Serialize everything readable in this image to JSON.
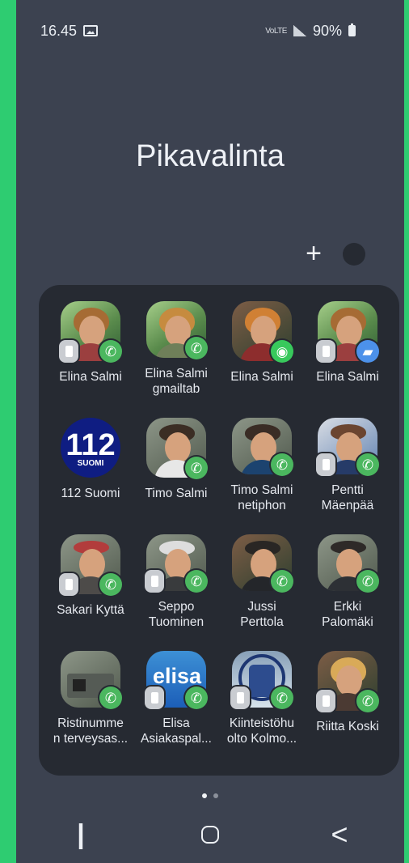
{
  "status_bar": {
    "time": "16.45",
    "network": "VoLTE",
    "battery": "90%"
  },
  "title": "Pikavalinta",
  "actions": {
    "add_label": "+"
  },
  "contacts": [
    {
      "label": "Elina Salmi"
    },
    {
      "label": "Elina Salmi\ngmailtab"
    },
    {
      "label": "Elina Salmi"
    },
    {
      "label": "Elina Salmi"
    },
    {
      "label": "112 Suomi",
      "logo_main": "112",
      "logo_sub": "SUOMI"
    },
    {
      "label": "Timo Salmi"
    },
    {
      "label": "Timo Salmi\nnetiphon"
    },
    {
      "label": "Pentti\nMäenpää"
    },
    {
      "label": "Sakari Kyttä"
    },
    {
      "label": "Seppo\nTuominen"
    },
    {
      "label": "Jussi\nPerttola"
    },
    {
      "label": "Erkki\nPalomäki"
    },
    {
      "label": "Ristinumme\nn terveysas..."
    },
    {
      "label": "Elisa\nAsiakaspal...",
      "logo_main": "elisa"
    },
    {
      "label": "Kiinteistöhu\nolto Kolmo..."
    },
    {
      "label": "Riitta Koski"
    }
  ],
  "navigation": {
    "recent": "|||",
    "back": "<"
  }
}
